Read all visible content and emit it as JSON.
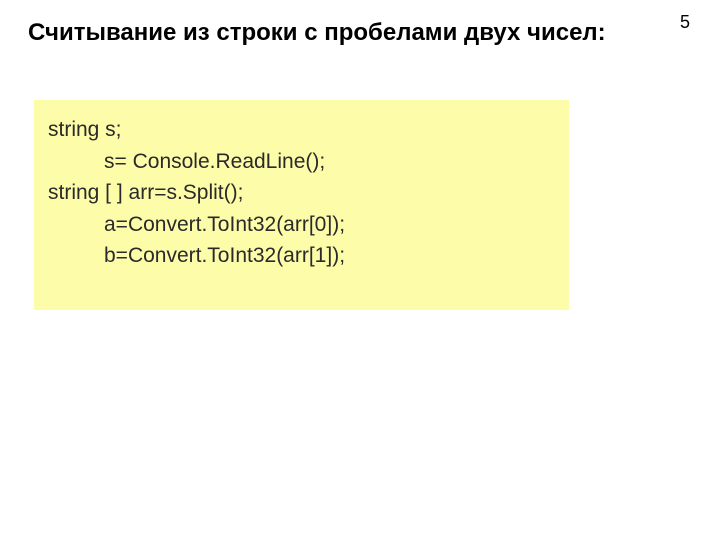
{
  "page_number": "5",
  "title": "Считывание из строки с пробелами двух чисел:",
  "code": {
    "line1": "string s;",
    "line2": "s= Console.ReadLine();",
    "line3": "string [ ] arr=s.Split();",
    "line4": "a=Convert.ToInt32(arr[0]);",
    "line5": "b=Convert.ToInt32(arr[1]);"
  }
}
